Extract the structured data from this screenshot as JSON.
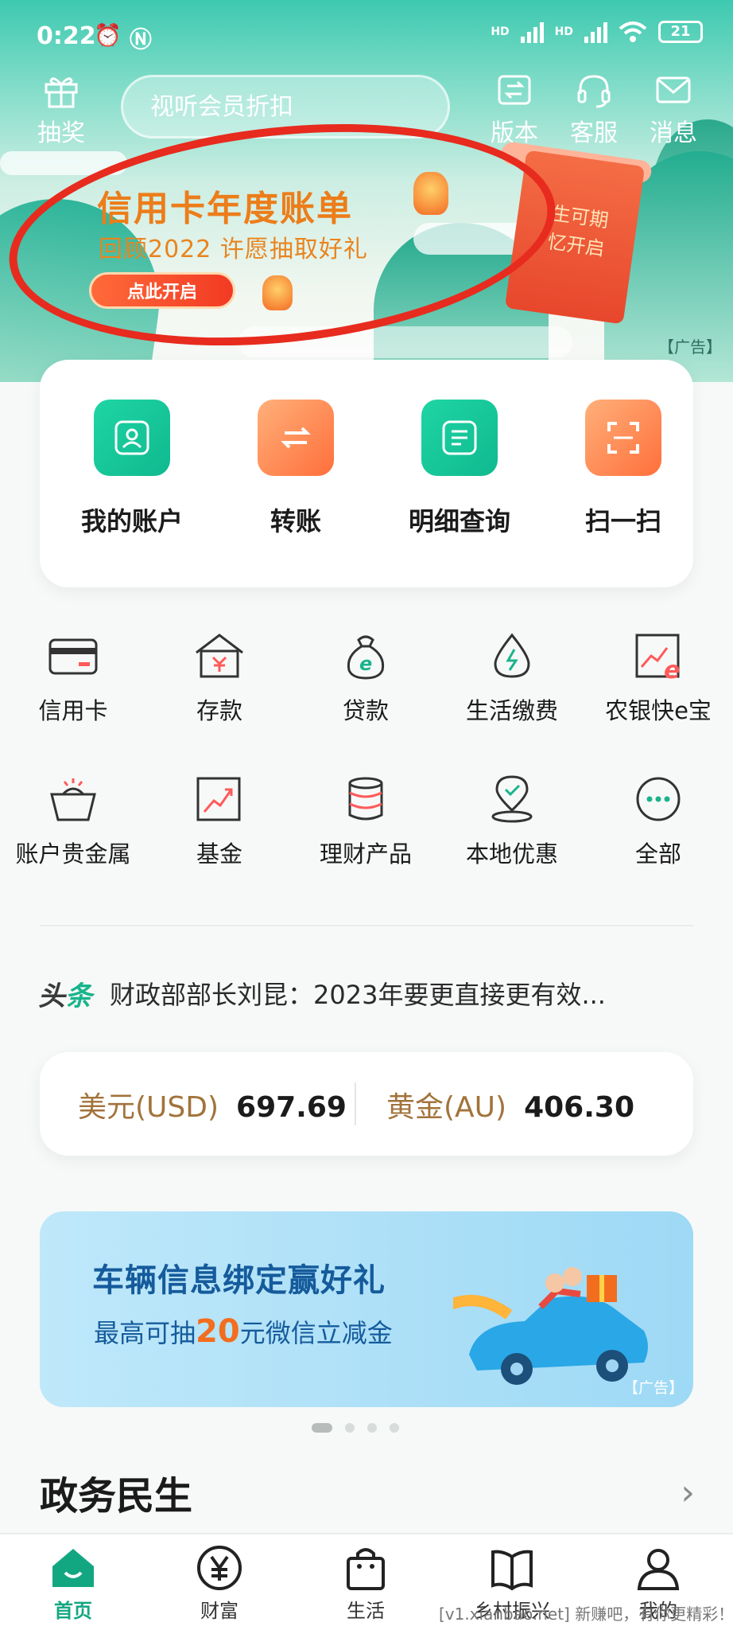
{
  "status_bar": {
    "time": "0:22",
    "hd1": "HD",
    "hd2": "HD",
    "battery": "21"
  },
  "header": {
    "lottery_label": "抽奖",
    "search_placeholder": "视听会员折扣",
    "version_label": "版本",
    "service_label": "客服",
    "message_label": "消息"
  },
  "banner": {
    "title": "信用卡年度账单",
    "subtitle": "回顾2022 许愿抽取好礼",
    "button": "点此开启",
    "scroll_text_1": "生可期",
    "scroll_text_2": "忆开启",
    "ad_tag": "【广告】"
  },
  "main_actions": [
    {
      "label": "我的账户",
      "icon": "user-icon"
    },
    {
      "label": "转账",
      "icon": "transfer-icon"
    },
    {
      "label": "明细查询",
      "icon": "list-icon"
    },
    {
      "label": "扫一扫",
      "icon": "scan-icon"
    }
  ],
  "services": [
    {
      "label": "信用卡",
      "icon": "credit-card-icon"
    },
    {
      "label": "存款",
      "icon": "deposit-icon"
    },
    {
      "label": "贷款",
      "icon": "loan-icon"
    },
    {
      "label": "生活缴费",
      "icon": "bill-pay-icon"
    },
    {
      "label": "农银快e宝",
      "icon": "fund-e-icon"
    },
    {
      "label": "账户贵金属",
      "icon": "precious-metal-icon"
    },
    {
      "label": "基金",
      "icon": "fund-chart-icon"
    },
    {
      "label": "理财产品",
      "icon": "coins-icon"
    },
    {
      "label": "本地优惠",
      "icon": "location-icon"
    },
    {
      "label": "全部",
      "icon": "more-icon"
    }
  ],
  "news": {
    "tag_a": "头",
    "tag_b": "条",
    "text": "财政部部长刘昆：2023年要更直接更有效..."
  },
  "rates": {
    "usd_label": "美元(USD)",
    "usd_value": "697.69",
    "gold_label": "黄金(AU)",
    "gold_value": "406.30"
  },
  "promo": {
    "title": "车辆信息绑定赢好礼",
    "sub_prefix": "最高可抽",
    "sub_amount": "20",
    "sub_suffix": "元微信立减金",
    "ad_tag": "【广告】"
  },
  "section": {
    "title": "政务民生",
    "arrow": "›"
  },
  "tabs": [
    {
      "label": "首页",
      "icon": "home-icon",
      "active": true
    },
    {
      "label": "财富",
      "icon": "yuan-icon",
      "active": false
    },
    {
      "label": "生活",
      "icon": "bag-icon",
      "active": false
    },
    {
      "label": "乡村振兴",
      "icon": "book-icon",
      "active": false
    },
    {
      "label": "我的",
      "icon": "profile-icon",
      "active": false
    }
  ],
  "watermark": "[v1.xianbao.net] 新赚吧，有你更精彩！",
  "colors": {
    "brand_green": "#13a781",
    "accent_orange": "#ff6f3b",
    "annotation_red": "#e72b1e"
  }
}
